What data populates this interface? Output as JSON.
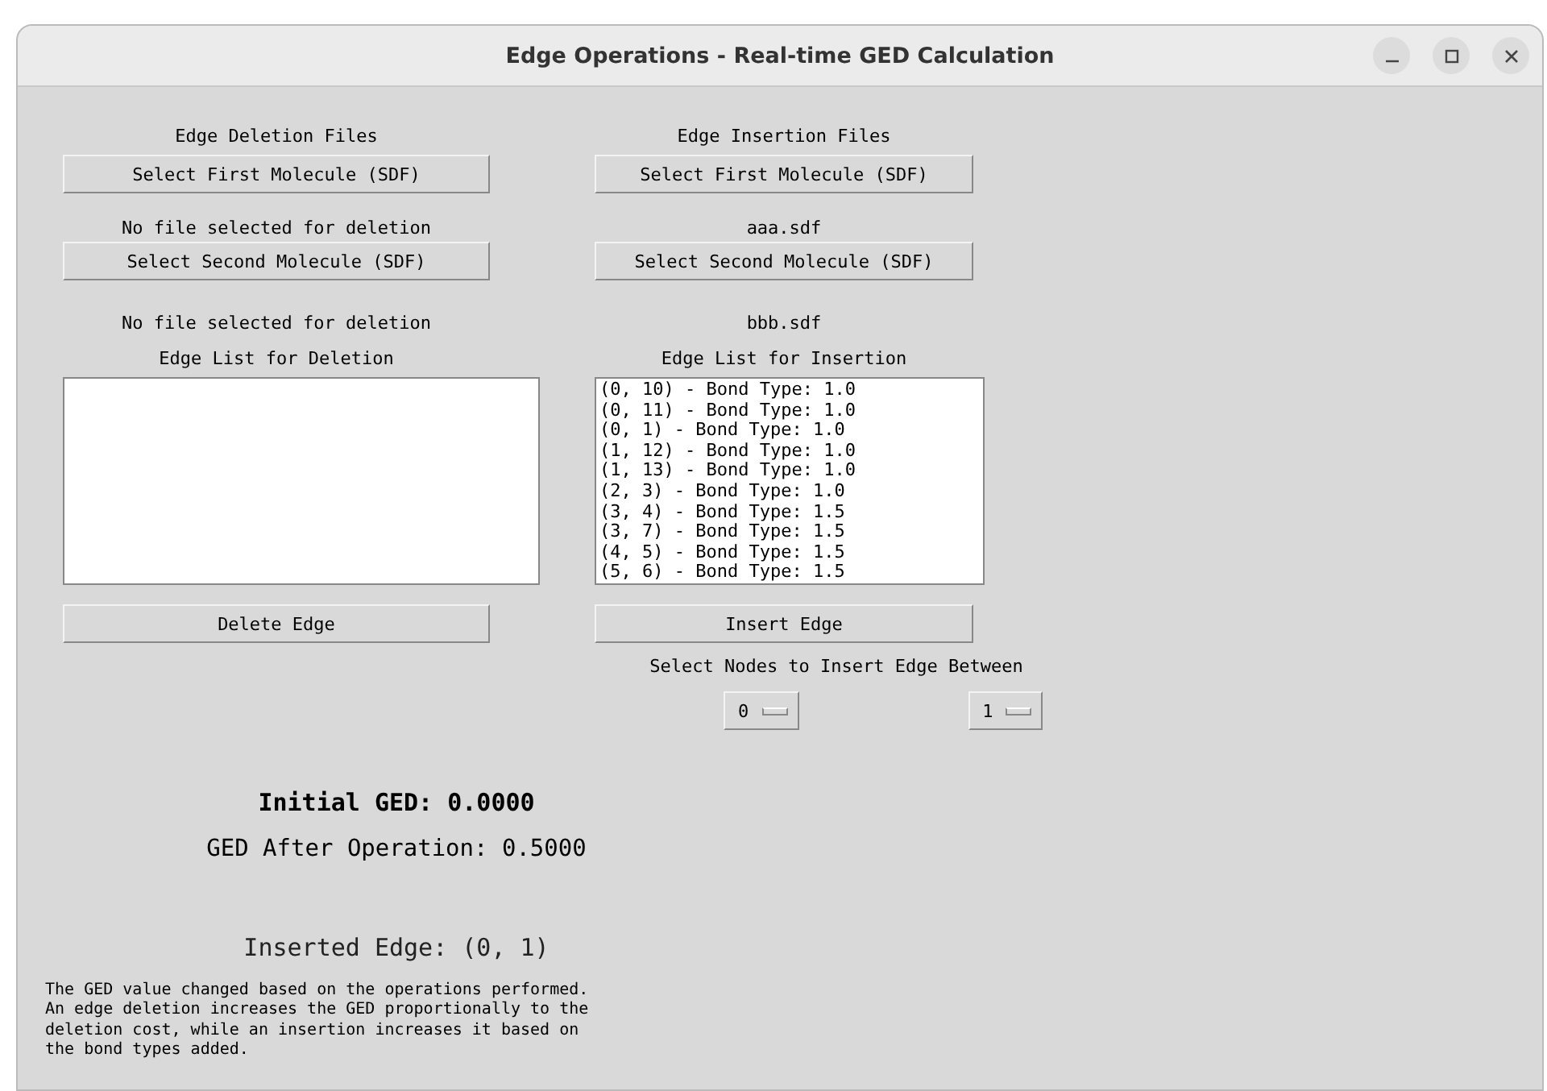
{
  "window": {
    "title": "Edge Operations - Real-time GED Calculation"
  },
  "deletion": {
    "heading": "Edge Deletion Files",
    "first_button": "Select First Molecule (SDF)",
    "first_status": "No file selected for deletion",
    "second_button": "Select Second Molecule (SDF)",
    "second_status": "No file selected for deletion",
    "list_title": "Edge List for Deletion",
    "action_button": "Delete Edge"
  },
  "insertion": {
    "heading": "Edge Insertion Files",
    "first_button": "Select First Molecule (SDF)",
    "first_status": "aaa.sdf",
    "second_button": "Select Second Molecule (SDF)",
    "second_status": "bbb.sdf",
    "list_title": "Edge List for Insertion",
    "edges": [
      "(0, 10) - Bond Type: 1.0",
      "(0, 11) - Bond Type: 1.0",
      "(0, 1) - Bond Type: 1.0",
      "(1, 12) - Bond Type: 1.0",
      "(1, 13) - Bond Type: 1.0",
      "(2, 3) - Bond Type: 1.0",
      "(3, 4) - Bond Type: 1.5",
      "(3, 7) - Bond Type: 1.5",
      "(4, 5) - Bond Type: 1.5",
      "(5, 6) - Bond Type: 1.5"
    ],
    "action_button": "Insert Edge"
  },
  "node_select": {
    "label": "Select Nodes to Insert Edge Between",
    "menus": [
      "0",
      "1"
    ]
  },
  "initial_ged": "Initial GED: 0.0000",
  "ged_after": "GED After Operation: 0.5000",
  "inserted_edge": "Inserted Edge: (0, 1)",
  "explanation": [
    "The GED value changed based on the operations performed.",
    "An edge deletion increases the GED proportionally to the",
    "deletion cost, while an insertion increases it based on",
    "the bond types added."
  ]
}
